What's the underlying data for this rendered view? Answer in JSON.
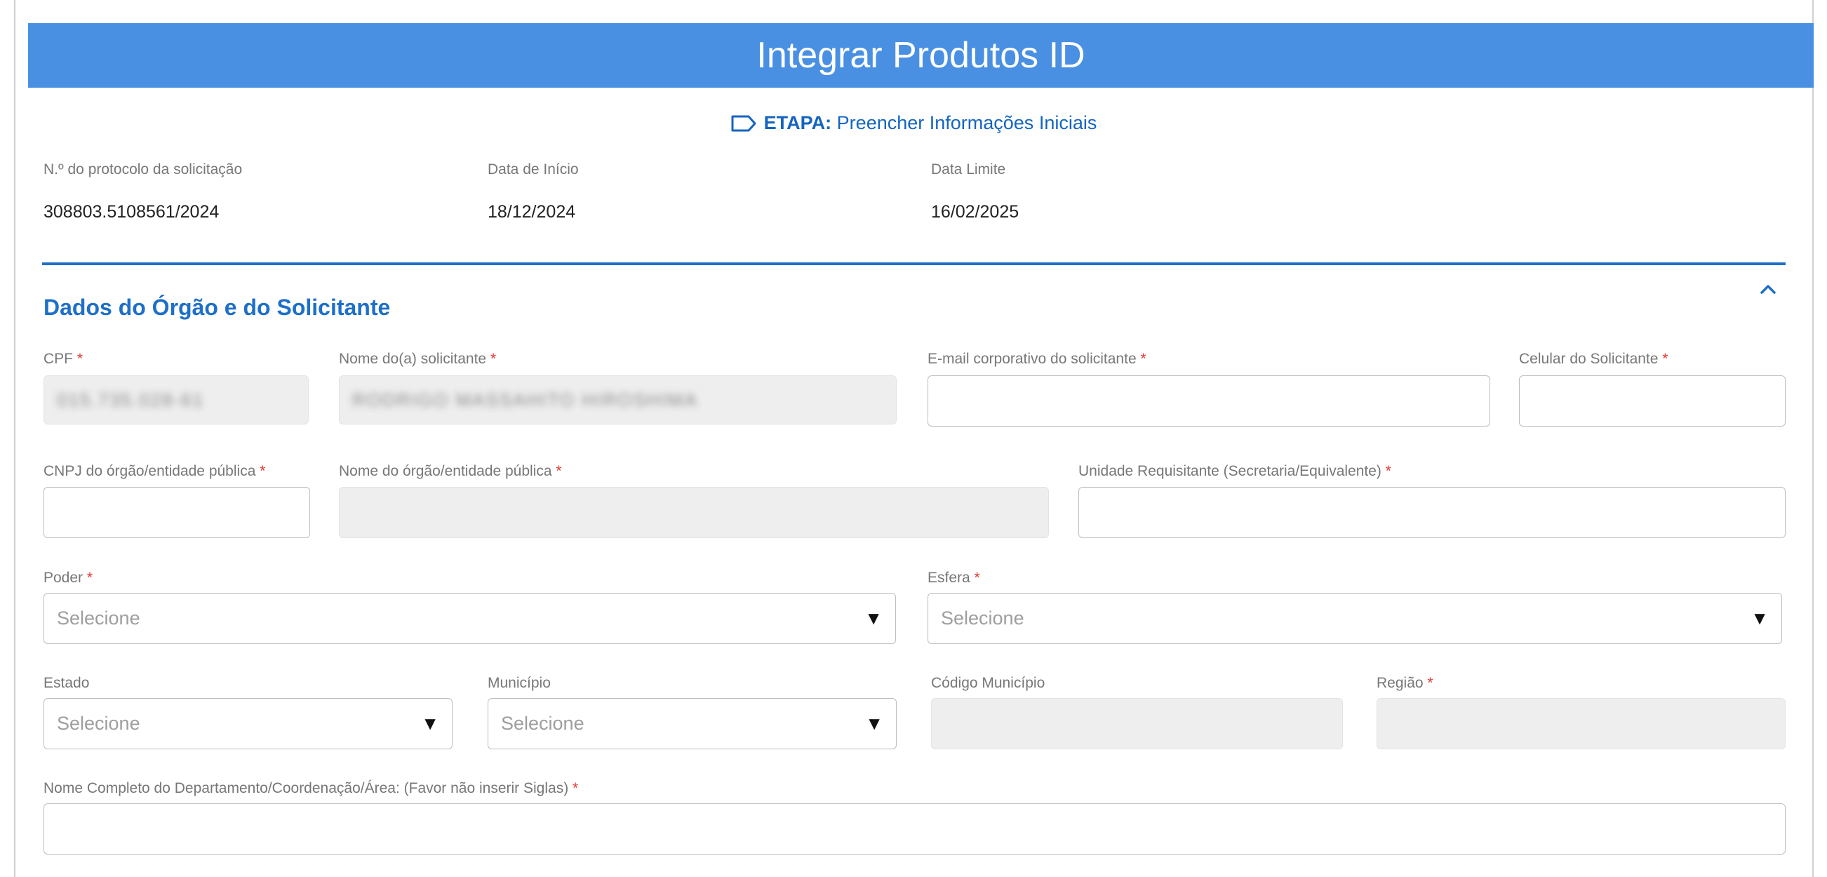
{
  "header": {
    "title": "Integrar Produtos ID"
  },
  "etapa": {
    "prefix": "ETAPA:",
    "text": "Preencher Informações Iniciais"
  },
  "meta": {
    "protocol_label": "N.º do protocolo da solicitação",
    "protocol_value": "308803.5108561/2024",
    "start_label": "Data de Início",
    "start_value": "18/12/2024",
    "deadline_label": "Data Limite",
    "deadline_value": "16/02/2025"
  },
  "section": {
    "title": "Dados do Órgão e do Solicitante"
  },
  "required_mark": "*",
  "fields": {
    "cpf": {
      "label": "CPF",
      "value": "015.735.028-61"
    },
    "nome_solicitante": {
      "label": "Nome do(a) solicitante",
      "value": "RODRIGO MASSAHITO HIROSHIMA"
    },
    "email": {
      "label": "E-mail corporativo do solicitante",
      "value": ""
    },
    "celular": {
      "label": "Celular do Solicitante",
      "value": ""
    },
    "cnpj": {
      "label": "CNPJ do órgão/entidade pública",
      "value": ""
    },
    "nome_orgao": {
      "label": "Nome do órgão/entidade pública",
      "value": ""
    },
    "unidade": {
      "label": "Unidade Requisitante (Secretaria/Equivalente)",
      "value": ""
    },
    "poder": {
      "label": "Poder",
      "placeholder": "Selecione"
    },
    "esfera": {
      "label": "Esfera",
      "placeholder": "Selecione"
    },
    "estado": {
      "label": "Estado",
      "placeholder": "Selecione"
    },
    "municipio": {
      "label": "Município",
      "placeholder": "Selecione"
    },
    "codigo_municipio": {
      "label": "Código Município",
      "value": ""
    },
    "regiao": {
      "label": "Região",
      "value": ""
    },
    "departamento": {
      "label": "Nome Completo do Departamento/Coordenação/Área: (Favor não inserir Siglas)",
      "value": ""
    }
  },
  "icons": {
    "select_arrow": "▼",
    "collapse": "chevron-up-icon",
    "etapa": "tag-icon"
  },
  "colors": {
    "header": "#4a90e2",
    "accent": "#1e6fc9",
    "required": "#e53935"
  }
}
